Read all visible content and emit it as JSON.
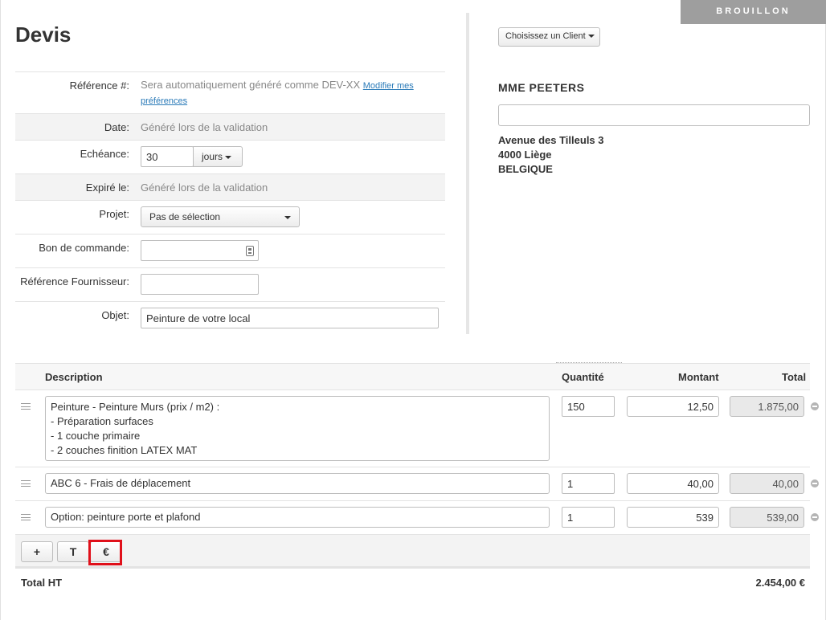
{
  "status": "BROUILLON",
  "title": "Devis",
  "form": {
    "reference": {
      "label": "Référence #:",
      "value": "Sera automatiquement généré comme DEV-XX",
      "link_line1": "Modifier mes",
      "link_line2": "préférences"
    },
    "date": {
      "label": "Date:",
      "value": "Généré lors de la validation"
    },
    "due": {
      "label": "Echéance:",
      "value": "30",
      "unit": "jours"
    },
    "expires": {
      "label": "Expiré le:",
      "value": "Généré lors de la validation"
    },
    "project": {
      "label": "Projet:",
      "value": "Pas de sélection"
    },
    "purchase_order": {
      "label": "Bon de commande:",
      "value": ""
    },
    "supplier_ref": {
      "label": "Référence Fournisseur:",
      "value": ""
    },
    "subject": {
      "label": "Objet:",
      "value": "Peinture de votre local"
    }
  },
  "client": {
    "choose_label": "Choisissez un Client",
    "name": "MME PEETERS",
    "field_value": "",
    "address_line1": "Avenue des Tilleuls 3",
    "address_line2": "4000 Liège",
    "address_line3": "BELGIQUE"
  },
  "lines": {
    "headers": {
      "description": "Description",
      "quantity": "Quantité",
      "amount": "Montant",
      "total": "Total"
    },
    "rows": [
      {
        "description": "Peinture - Peinture Murs (prix / m2) :\n- Préparation surfaces\n- 1 couche primaire\n- 2 couches finition LATEX MAT",
        "quantity": "150",
        "amount": "12,50",
        "total": "1.875,00"
      },
      {
        "description": "ABC 6 - Frais de déplacement",
        "quantity": "1",
        "amount": "40,00",
        "total": "40,00"
      },
      {
        "description": "Option: peinture porte et plafond",
        "quantity": "1",
        "amount": "539",
        "total": "539,00"
      }
    ]
  },
  "toolbar": {
    "add_label": "+",
    "text_label": "T",
    "euro_label": "€"
  },
  "totals": {
    "label": "Total HT",
    "value": "2.454,00 €"
  }
}
